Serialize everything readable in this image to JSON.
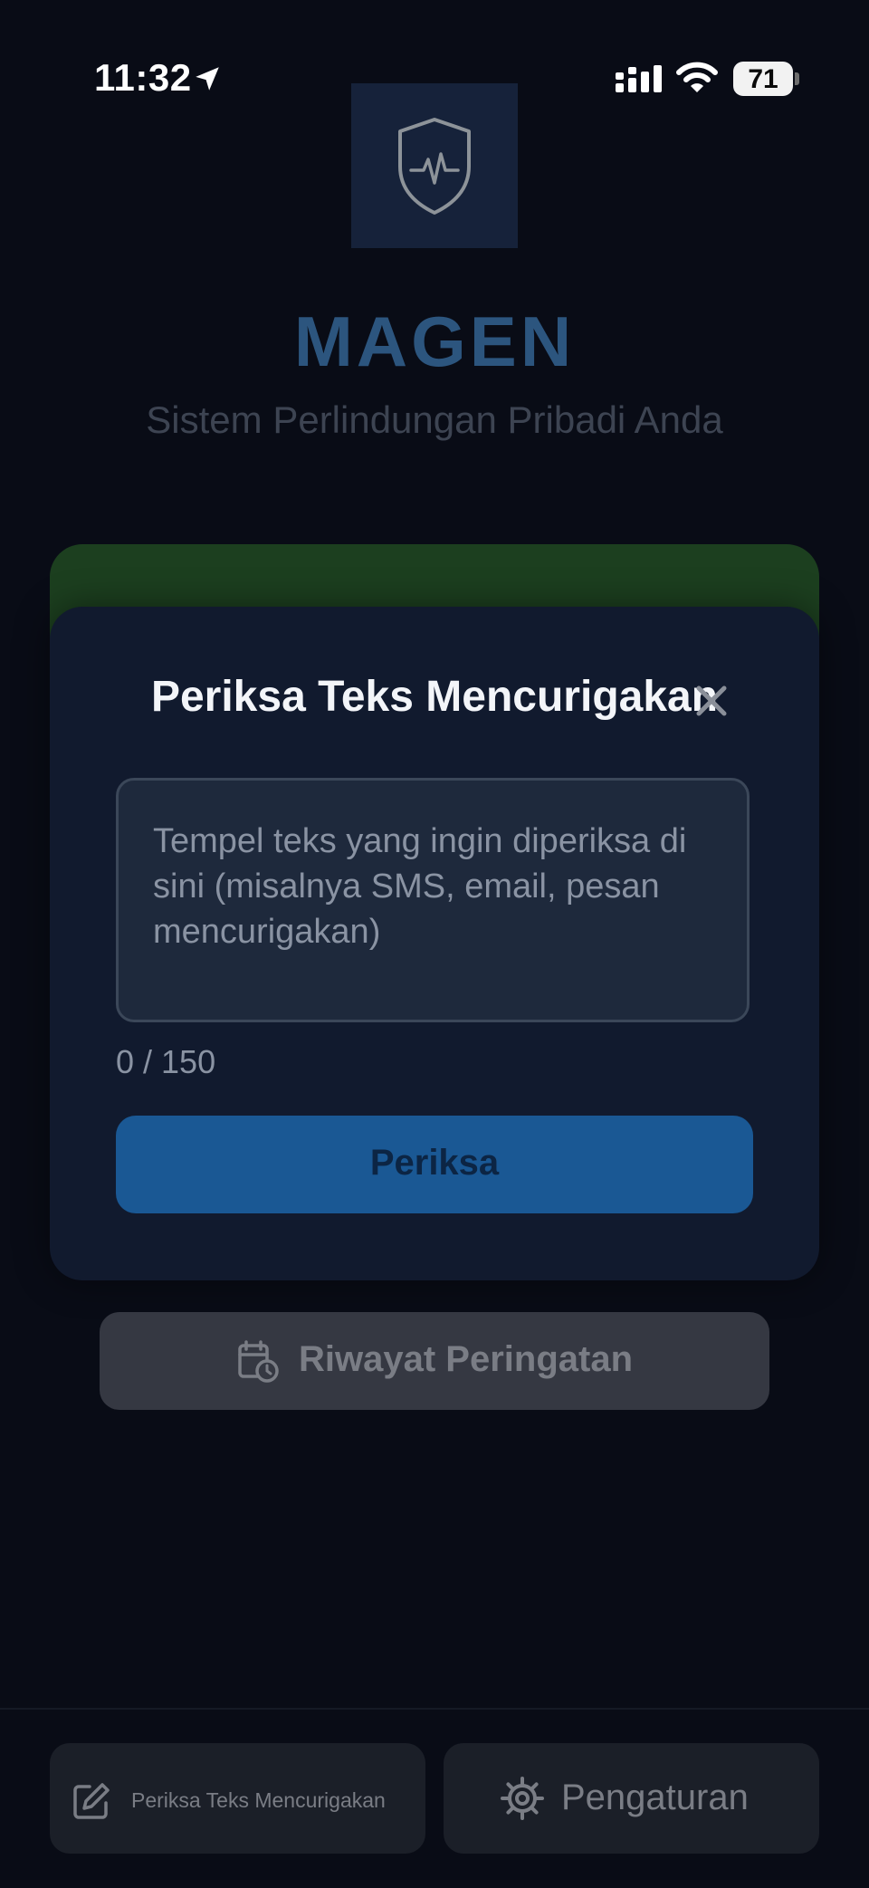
{
  "status_bar": {
    "time": "11:32",
    "battery": "71"
  },
  "header": {
    "title": "MAGEN",
    "subtitle": "Sistem Perlindungan Pribadi Anda"
  },
  "modal": {
    "title": "Periksa Teks Mencurigakan",
    "placeholder": "Tempel teks yang ingin diperiksa di sini (misalnya SMS, email, pesan mencurigakan)",
    "char_count": "0 / 150",
    "check_label": "Periksa"
  },
  "history_button": {
    "label": "Riwayat Peringatan"
  },
  "bottom_bar": {
    "check_text_label": "Periksa Teks Mencurigakan",
    "settings_label": "Pengaturan"
  },
  "icons": {
    "location": "location-arrow-icon",
    "signal": "signal-icon",
    "wifi": "wifi-icon",
    "logo": "shield-pulse-icon",
    "close": "close-icon",
    "history": "calendar-clock-icon",
    "edit": "edit-icon",
    "settings": "gear-icon"
  },
  "colors": {
    "background": "#090c16",
    "accent_blue": "#1a5894",
    "title_blue": "#2c557e",
    "status_green": "#1c3f1f",
    "modal_bg": "#111a2e"
  }
}
